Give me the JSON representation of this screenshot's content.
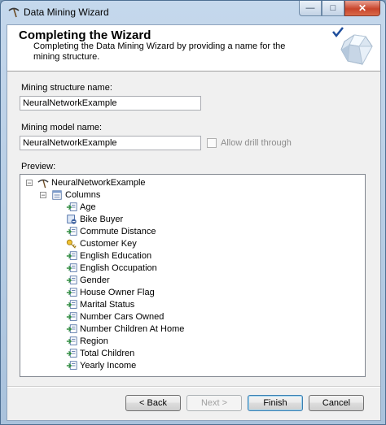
{
  "window": {
    "title": "Data Mining Wizard"
  },
  "caption_buttons": {
    "minimize": "—",
    "maximize": "□",
    "close": "✕"
  },
  "header": {
    "title": "Completing the Wizard",
    "subtitle": "Completing the Data Mining Wizard by providing a name for the mining structure."
  },
  "form": {
    "structure_name_label": "Mining structure name:",
    "structure_name_value": "NeuralNetworkExample",
    "model_name_label": "Mining model name:",
    "model_name_value": "NeuralNetworkExample",
    "allow_drill_through_label": "Allow drill through",
    "allow_drill_through_checked": false,
    "preview_label": "Preview:"
  },
  "tree": {
    "root": "NeuralNetworkExample",
    "columns_node": "Columns",
    "columns": [
      {
        "name": "Age",
        "icon": "input-column-icon"
      },
      {
        "name": "Bike Buyer",
        "icon": "predict-column-icon"
      },
      {
        "name": "Commute Distance",
        "icon": "input-column-icon"
      },
      {
        "name": "Customer Key",
        "icon": "key-column-icon"
      },
      {
        "name": "English Education",
        "icon": "input-column-icon"
      },
      {
        "name": "English Occupation",
        "icon": "input-column-icon"
      },
      {
        "name": "Gender",
        "icon": "input-column-icon"
      },
      {
        "name": "House Owner Flag",
        "icon": "input-column-icon"
      },
      {
        "name": "Marital Status",
        "icon": "input-column-icon"
      },
      {
        "name": "Number Cars Owned",
        "icon": "input-column-icon"
      },
      {
        "name": "Number Children At Home",
        "icon": "input-column-icon"
      },
      {
        "name": "Region",
        "icon": "input-column-icon"
      },
      {
        "name": "Total Children",
        "icon": "input-column-icon"
      },
      {
        "name": "Yearly Income",
        "icon": "input-column-icon"
      }
    ]
  },
  "buttons": {
    "back": "< Back",
    "next": "Next >",
    "finish": "Finish",
    "cancel": "Cancel"
  }
}
